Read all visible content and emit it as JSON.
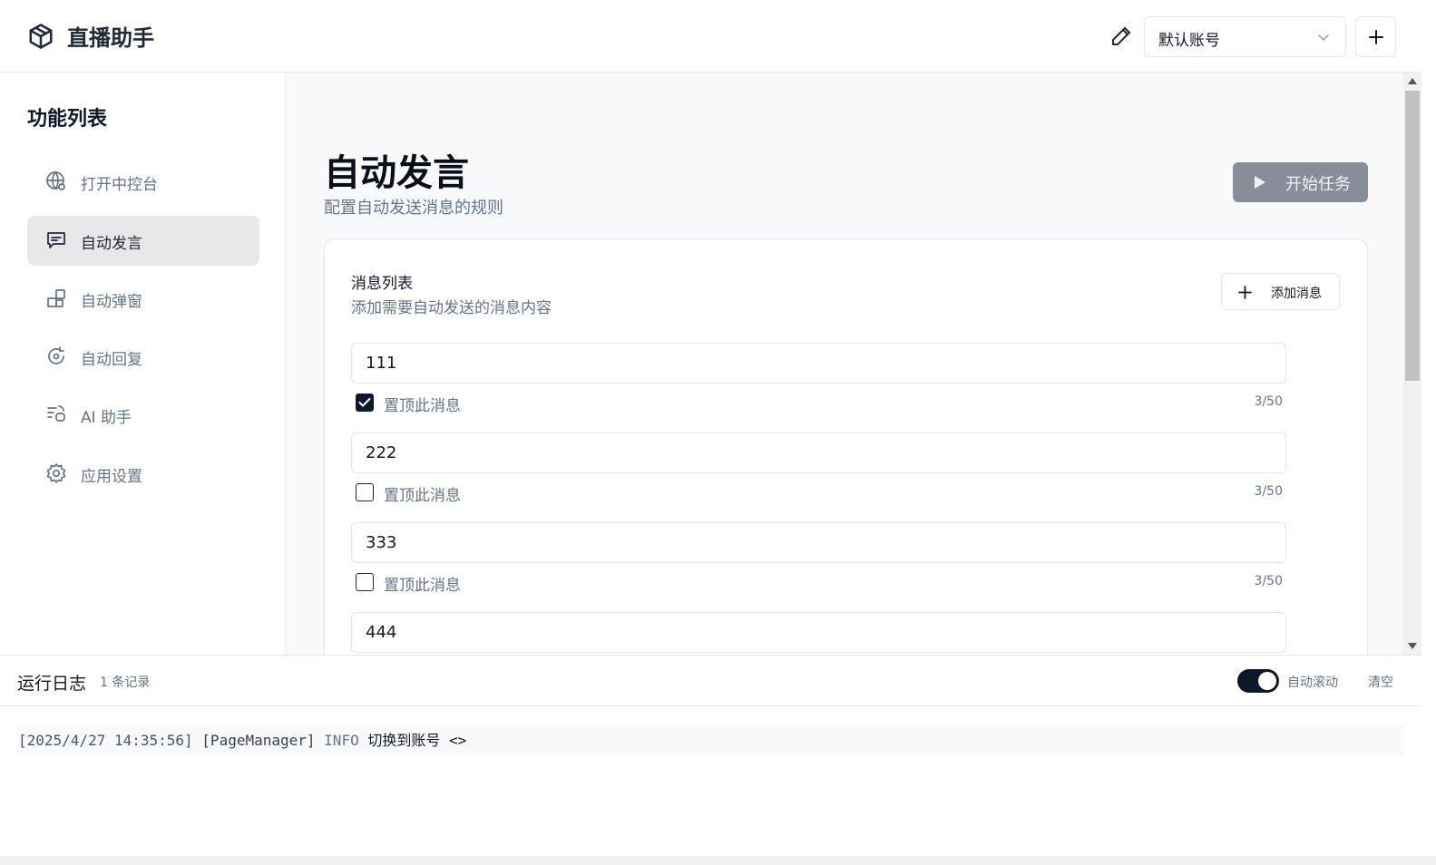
{
  "header": {
    "app_title": "直播助手",
    "account_selected": "默认账号"
  },
  "sidebar": {
    "title": "功能列表",
    "items": [
      {
        "label": "打开中控台",
        "icon": "globe-icon"
      },
      {
        "label": "自动发言",
        "icon": "message-square-icon",
        "active": true
      },
      {
        "label": "自动弹窗",
        "icon": "package-icon"
      },
      {
        "label": "自动回复",
        "icon": "refresh-icon"
      },
      {
        "label": "AI 助手",
        "icon": "ai-chat-icon"
      },
      {
        "label": "应用设置",
        "icon": "gear-icon"
      }
    ]
  },
  "main": {
    "title": "自动发言",
    "subtitle": "配置自动发送消息的规则",
    "start_button": "开始任务",
    "card": {
      "title": "消息列表",
      "description": "添加需要自动发送的消息内容",
      "add_button": "添加消息",
      "pin_label": "置顶此消息",
      "messages": [
        {
          "text": "111",
          "pinned": true,
          "counter": "3/50"
        },
        {
          "text": "222",
          "pinned": false,
          "counter": "3/50"
        },
        {
          "text": "333",
          "pinned": false,
          "counter": "3/50"
        },
        {
          "text": "444"
        }
      ]
    }
  },
  "log": {
    "title": "运行日志",
    "count": "1 条记录",
    "auto_scroll_label": "自动滚动",
    "auto_scroll_on": true,
    "clear_label": "清空",
    "entries": [
      {
        "timestamp": "[2025/4/27 14:35:56]",
        "module": "[PageManager]",
        "level": "INFO",
        "message": "切换到账号 <>"
      }
    ]
  },
  "colors": {
    "accent": "#0f172a",
    "muted_text": "#64748b",
    "start_button_bg": "#878e99",
    "active_nav_bg": "#e8e8ea"
  }
}
